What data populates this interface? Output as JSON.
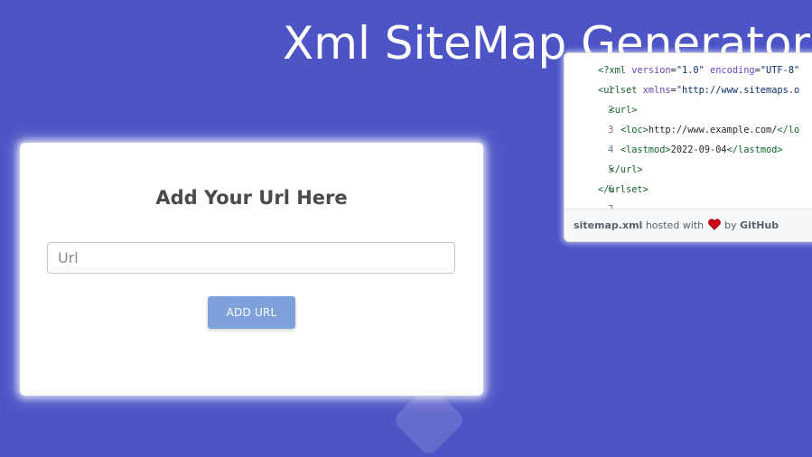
{
  "page": {
    "title": "Xml SiteMap Generator"
  },
  "form": {
    "heading": "Add Your Url Here",
    "url_placeholder": "Url",
    "url_value": "",
    "add_button_label": "ADD URL"
  },
  "gist": {
    "lines": [
      {
        "num": "1",
        "text": "<?xml version=\"1.0\" encoding=\"UTF-8\""
      },
      {
        "num": "2",
        "text": "<urlset xmlns=\"http://www.sitemaps.o"
      },
      {
        "num": "3",
        "text": "  <url>"
      },
      {
        "num": "4",
        "text": "    <loc>http://www.example.com/</lo"
      },
      {
        "num": "5",
        "text": "    <lastmod>2022-09-04</lastmod>"
      },
      {
        "num": "6",
        "text": "  </url>"
      },
      {
        "num": "7",
        "text": "</urlset>"
      }
    ],
    "footer": {
      "filename": "sitemap.xml",
      "hosted_text": "hosted with",
      "by_text": "by",
      "host_name": "GitHub"
    }
  },
  "colors": {
    "background": "#4c54c6",
    "button": "#7ea1dc",
    "heart": "#d0021b"
  },
  "icons": {
    "footer_icon": "heart-icon"
  }
}
